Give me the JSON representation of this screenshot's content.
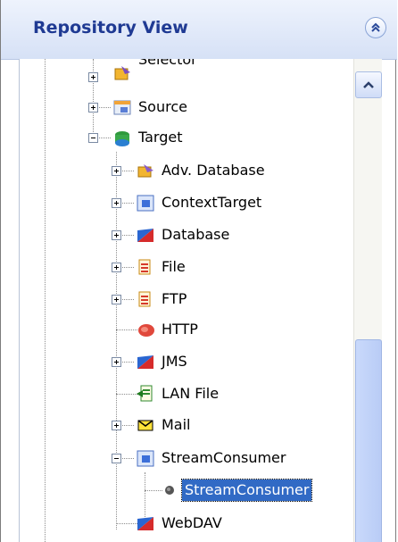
{
  "header": {
    "title": "Repository View",
    "collapse_icon": "double-chevron-up-icon"
  },
  "tree": {
    "items": [
      {
        "label": "Selector",
        "icon": "selector-icon",
        "expander": "plus"
      },
      {
        "label": "Source",
        "icon": "source-icon",
        "expander": "plus"
      },
      {
        "label": "Target",
        "icon": "target-icon",
        "expander": "minus"
      },
      {
        "label": "Adv. Database",
        "icon": "adv-database-icon",
        "expander": "plus"
      },
      {
        "label": "ContextTarget",
        "icon": "context-target-icon",
        "expander": "plus"
      },
      {
        "label": "Database",
        "icon": "database-icon",
        "expander": "plus"
      },
      {
        "label": "File",
        "icon": "file-icon",
        "expander": "plus"
      },
      {
        "label": "FTP",
        "icon": "ftp-icon",
        "expander": "plus"
      },
      {
        "label": "HTTP",
        "icon": "http-icon",
        "expander": "none"
      },
      {
        "label": "JMS",
        "icon": "jms-icon",
        "expander": "plus"
      },
      {
        "label": "LAN File",
        "icon": "lan-file-icon",
        "expander": "none"
      },
      {
        "label": "Mail",
        "icon": "mail-icon",
        "expander": "plus"
      },
      {
        "label": "StreamConsumer",
        "icon": "stream-consumer-icon",
        "expander": "minus"
      },
      {
        "label": "StreamConsumer",
        "icon": "bullet-icon",
        "expander": "none",
        "selected": true
      },
      {
        "label": "WebDAV",
        "icon": "webdav-icon",
        "expander": "none"
      }
    ]
  },
  "scrollbar": {
    "up_icon": "chevron-up-icon"
  },
  "colors": {
    "selection": "#316ac5",
    "title": "#1f3a93",
    "header_bg": "#d6e1f6"
  }
}
